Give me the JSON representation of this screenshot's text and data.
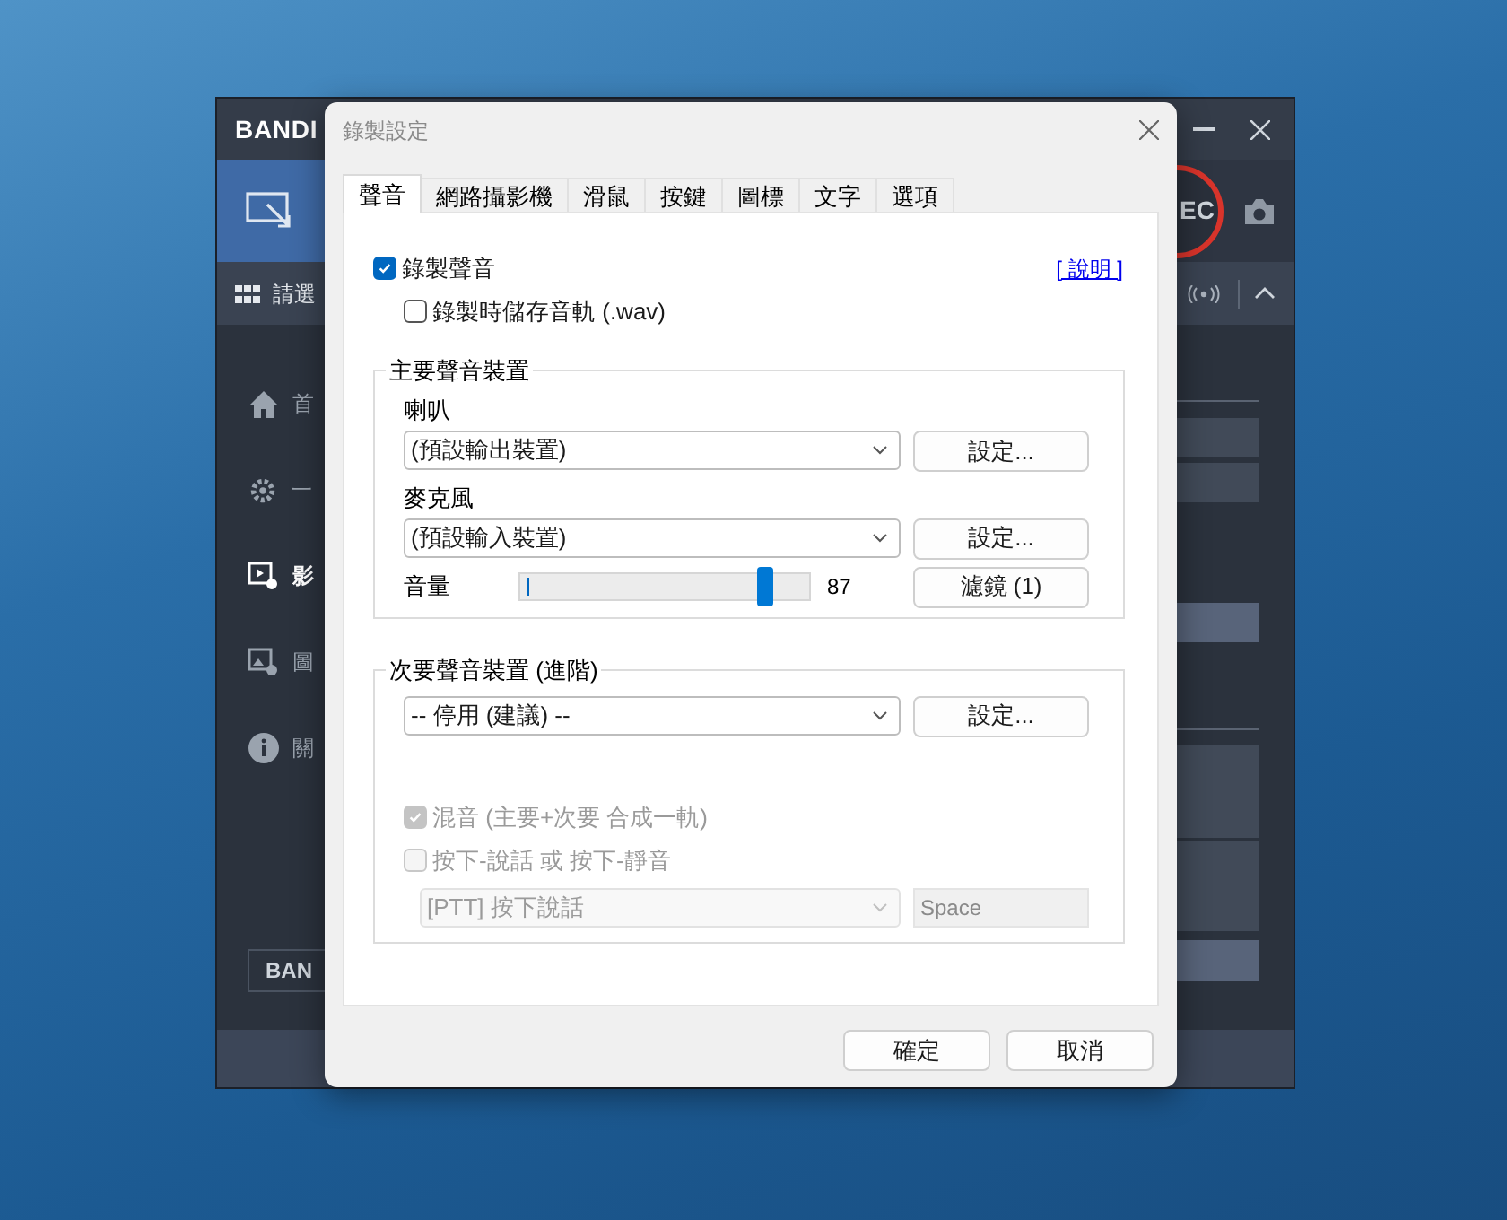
{
  "background_app": {
    "logo": "BANDI",
    "rec_label": "EC",
    "mode_label": "請選",
    "sidebar": [
      {
        "label": "首",
        "selected": false
      },
      {
        "label": "一",
        "selected": false
      },
      {
        "label": "影",
        "selected": true
      },
      {
        "label": "圖",
        "selected": false
      },
      {
        "label": "關",
        "selected": false
      }
    ],
    "footer_logo": "BAN"
  },
  "dialog": {
    "title": "錄製設定",
    "tabs": [
      {
        "label": "聲音",
        "selected": true
      },
      {
        "label": "網路攝影機",
        "selected": false
      },
      {
        "label": "滑鼠",
        "selected": false
      },
      {
        "label": "按鍵",
        "selected": false
      },
      {
        "label": "圖標",
        "selected": false
      },
      {
        "label": "文字",
        "selected": false
      },
      {
        "label": "選項",
        "selected": false
      }
    ],
    "record_audio": {
      "label": "錄製聲音",
      "checked": true
    },
    "help_link": "[ 說明 ]",
    "save_wav": {
      "label": "錄製時儲存音軌 (.wav)",
      "checked": false
    },
    "primary": {
      "legend": "主要聲音裝置",
      "speaker_label": "喇叭",
      "speaker_value": "(預設輸出裝置)",
      "speaker_button": "設定...",
      "mic_label": "麥克風",
      "mic_value": "(預設輸入裝置)",
      "mic_button": "設定...",
      "volume_label": "音量",
      "volume": {
        "level": 0.87
      },
      "volume_reading": "87",
      "filter_button": "濾鏡 (1)"
    },
    "secondary": {
      "legend": "次要聲音裝置 (進階)",
      "device_value": "-- 停用 (建議) --",
      "device_button": "設定...",
      "mix": {
        "label": "混音 (主要+次要 合成一軌)",
        "checked": true,
        "disabled": true
      },
      "ptt": {
        "label": "按下-說話 或 按下-靜音",
        "checked": false,
        "disabled": true
      },
      "ptt_mode": {
        "value": "[PTT] 按下說話",
        "disabled": true
      },
      "ptt_key": "Space"
    },
    "buttons": [
      "確定",
      "取消"
    ]
  }
}
